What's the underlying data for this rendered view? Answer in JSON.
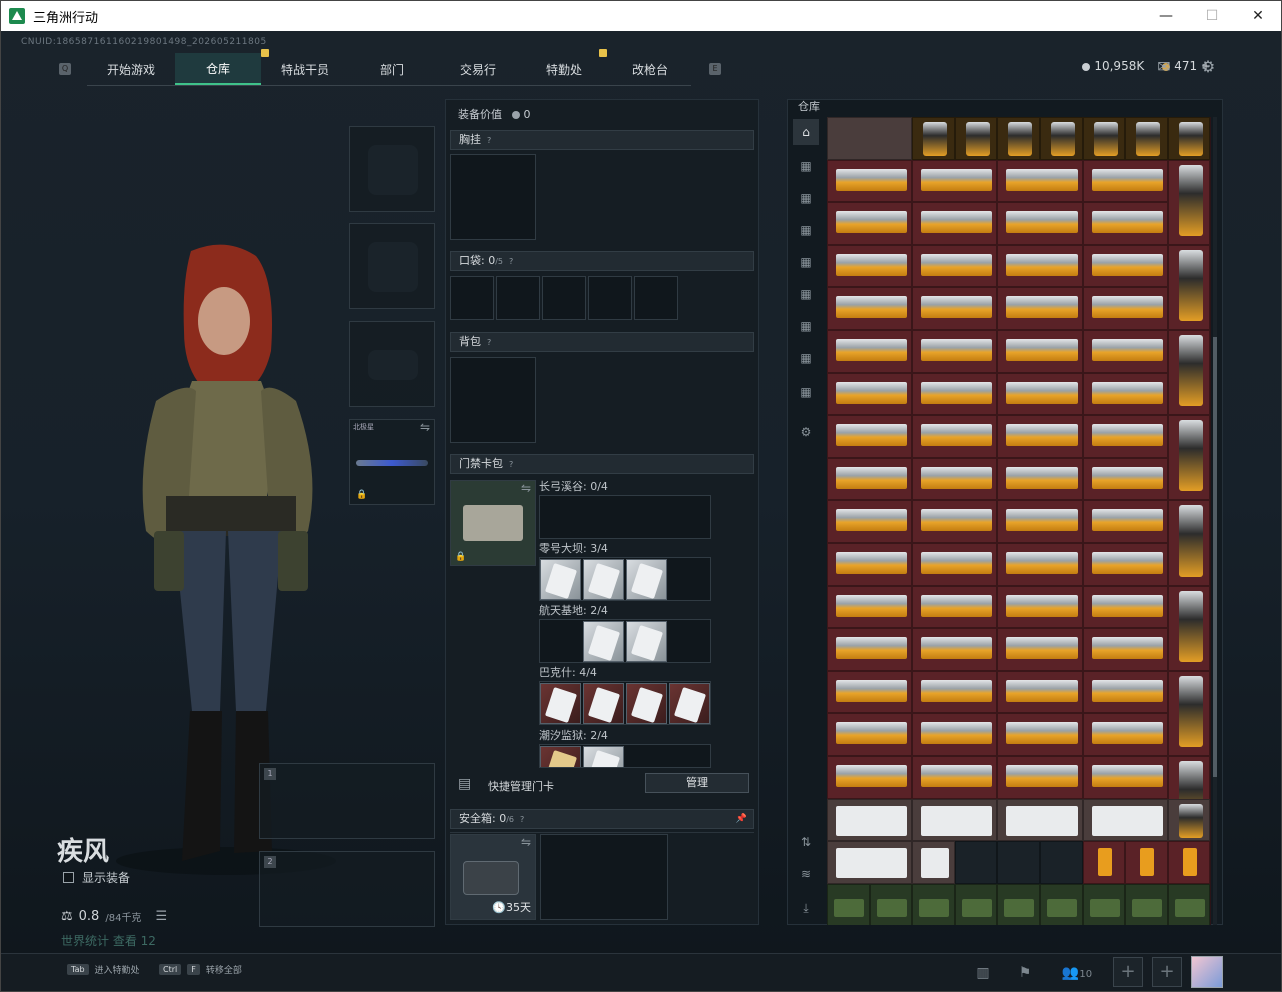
{
  "window": {
    "title": "三角洲行动",
    "minimize": "—",
    "maximize": "☐",
    "close": "✕"
  },
  "uid": "CNUID:186587161160219801498_202605211805",
  "nav": {
    "tabs": [
      {
        "label": "开始游戏"
      },
      {
        "label": "仓库",
        "active": true
      },
      {
        "label": "特战干员"
      },
      {
        "label": "部门"
      },
      {
        "label": "交易行"
      },
      {
        "label": "特勤处"
      },
      {
        "label": "改枪台"
      }
    ]
  },
  "currency": {
    "coins": "10,958K",
    "tickets": "471",
    "plus": "+"
  },
  "character": {
    "name": "疾风",
    "show_equipment": "显示装备",
    "weight": "0.8",
    "weight_max": "/84千克",
    "prompt_text": "世界统计 查看 12"
  },
  "equipment": {
    "value_label": "装备价值",
    "value": "0",
    "chest_rig": "胸挂",
    "pocket_label": "口袋:",
    "pocket_value": "0",
    "pocket_max": "/5",
    "backpack": "背包",
    "keycard_label": "门禁卡包",
    "weapon_name": "北极星",
    "maps": [
      {
        "name": "长弓溪谷",
        "count": "0/4"
      },
      {
        "name": "零号大坝",
        "count": "3/4"
      },
      {
        "name": "航天基地",
        "count": "2/4"
      },
      {
        "name": "巴克什",
        "count": "4/4"
      },
      {
        "name": "潮汐监狱",
        "count": "2/4"
      }
    ],
    "quick_manage": "快捷管理门卡",
    "manage_btn": "管理",
    "safebox_label": "安全箱:",
    "safebox_value": "0",
    "safebox_max": "/6",
    "safebox_days": "35天"
  },
  "warehouse": {
    "title": "仓库"
  },
  "bottom": {
    "tab_key": "Tab",
    "tab_action": "进入特勤处",
    "ctrl_key": "Ctrl",
    "f_key": "F",
    "ctrl_action": "转移全部",
    "friends_count": "10"
  }
}
